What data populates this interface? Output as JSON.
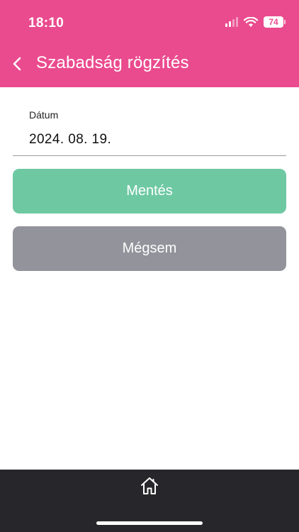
{
  "status_bar": {
    "time": "18:10",
    "battery": "74",
    "icons": [
      "cellular-signal-icon",
      "wifi-icon",
      "battery-icon"
    ]
  },
  "header": {
    "back_icon": "chevron-left-icon",
    "title": "Szabadság rögzítés",
    "color": "#ea4b8e"
  },
  "form": {
    "date_label": "Dátum",
    "date_value": "2024. 08. 19."
  },
  "buttons": {
    "save_label": "Mentés",
    "save_color": "#6ec9a3",
    "cancel_label": "Mégsem",
    "cancel_color": "#92939b"
  },
  "bottom_nav": {
    "items": [
      {
        "icon": "home-icon"
      }
    ]
  }
}
